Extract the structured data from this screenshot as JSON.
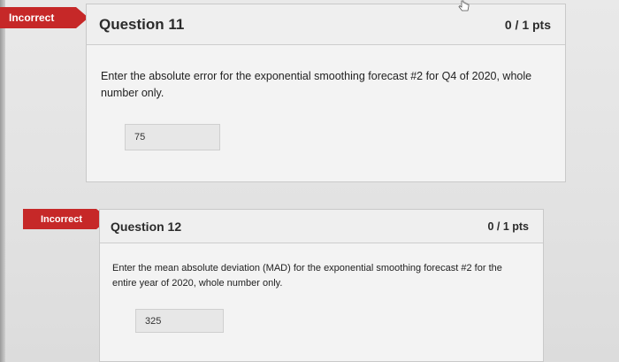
{
  "questions": [
    {
      "status": "Incorrect",
      "title": "Question 11",
      "points": "0 / 1 pts",
      "prompt": "Enter the absolute error for the exponential smoothing forecast #2 for Q4 of 2020, whole number only.",
      "answer": "75"
    },
    {
      "status": "Incorrect",
      "title": "Question 12",
      "points": "0 / 1 pts",
      "prompt": "Enter the mean absolute deviation (MAD) for the exponential smoothing forecast #2 for the entire year of 2020, whole number only.",
      "answer": "325"
    }
  ],
  "colors": {
    "incorrect_badge": "#c62828"
  },
  "icons": {
    "pointer": "hand-pointer-icon"
  }
}
